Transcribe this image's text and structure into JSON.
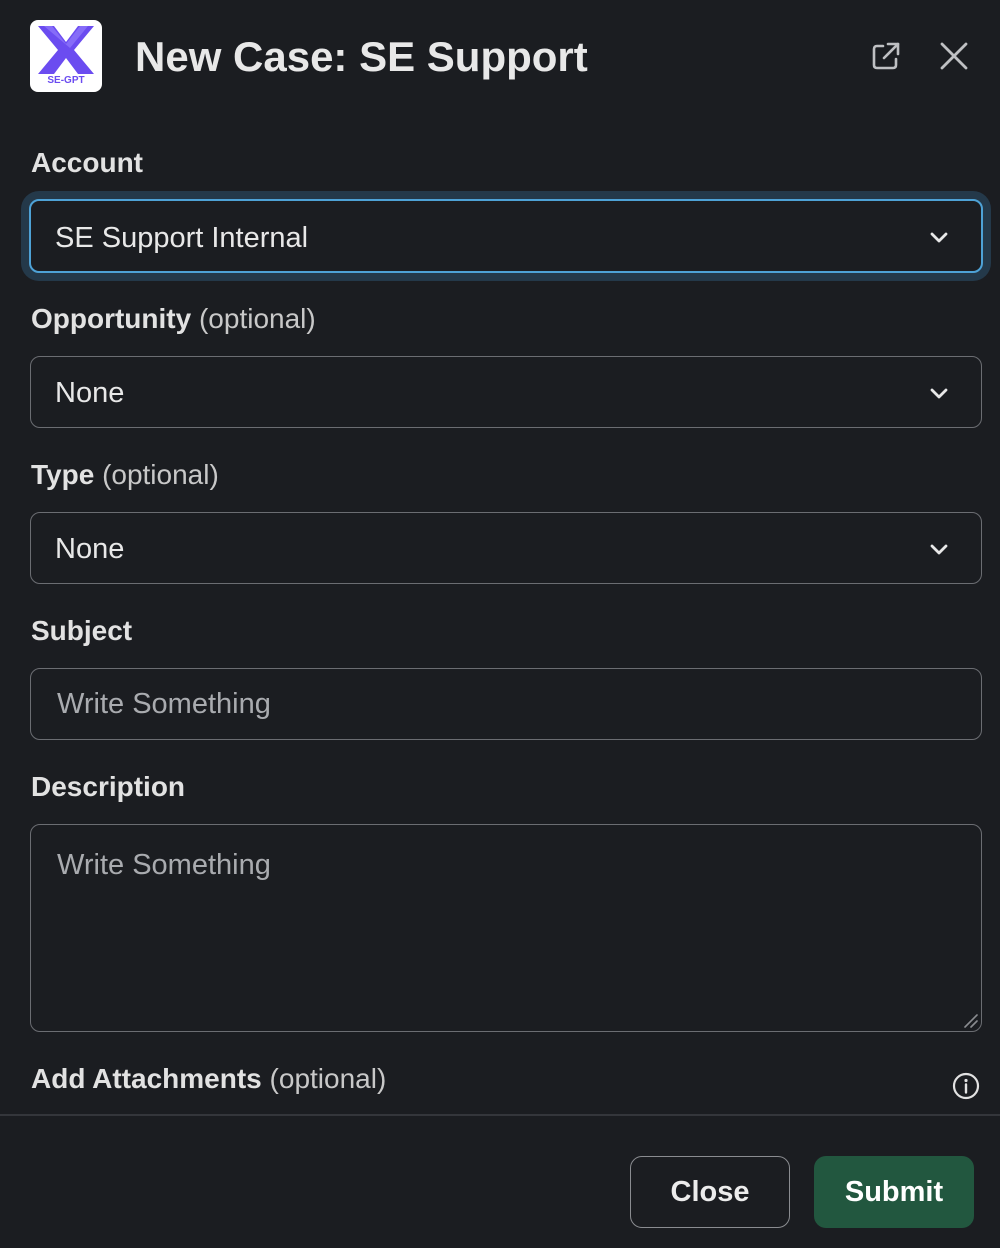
{
  "header": {
    "logo_text": "SE-GPT",
    "title": "New Case: SE Support"
  },
  "fields": {
    "account": {
      "label": "Account",
      "value": "SE Support Internal"
    },
    "opportunity": {
      "label": "Opportunity",
      "optional": "(optional)",
      "value": "None"
    },
    "type": {
      "label": "Type",
      "optional": "(optional)",
      "value": "None"
    },
    "subject": {
      "label": "Subject",
      "placeholder": "Write Something"
    },
    "description": {
      "label": "Description",
      "placeholder": "Write Something"
    },
    "attachments": {
      "label": "Add Attachments",
      "optional": "(optional)"
    }
  },
  "footer": {
    "close_label": "Close",
    "submit_label": "Submit"
  },
  "colors": {
    "background": "#1b1d21",
    "focus_border": "#4ea2d6",
    "submit": "#22573f",
    "logo_purple": "#6b4cf0"
  },
  "icons": [
    "open-in-new-window-icon",
    "close-icon",
    "chevron-down-icon",
    "info-icon",
    "resize-handle-icon"
  ]
}
